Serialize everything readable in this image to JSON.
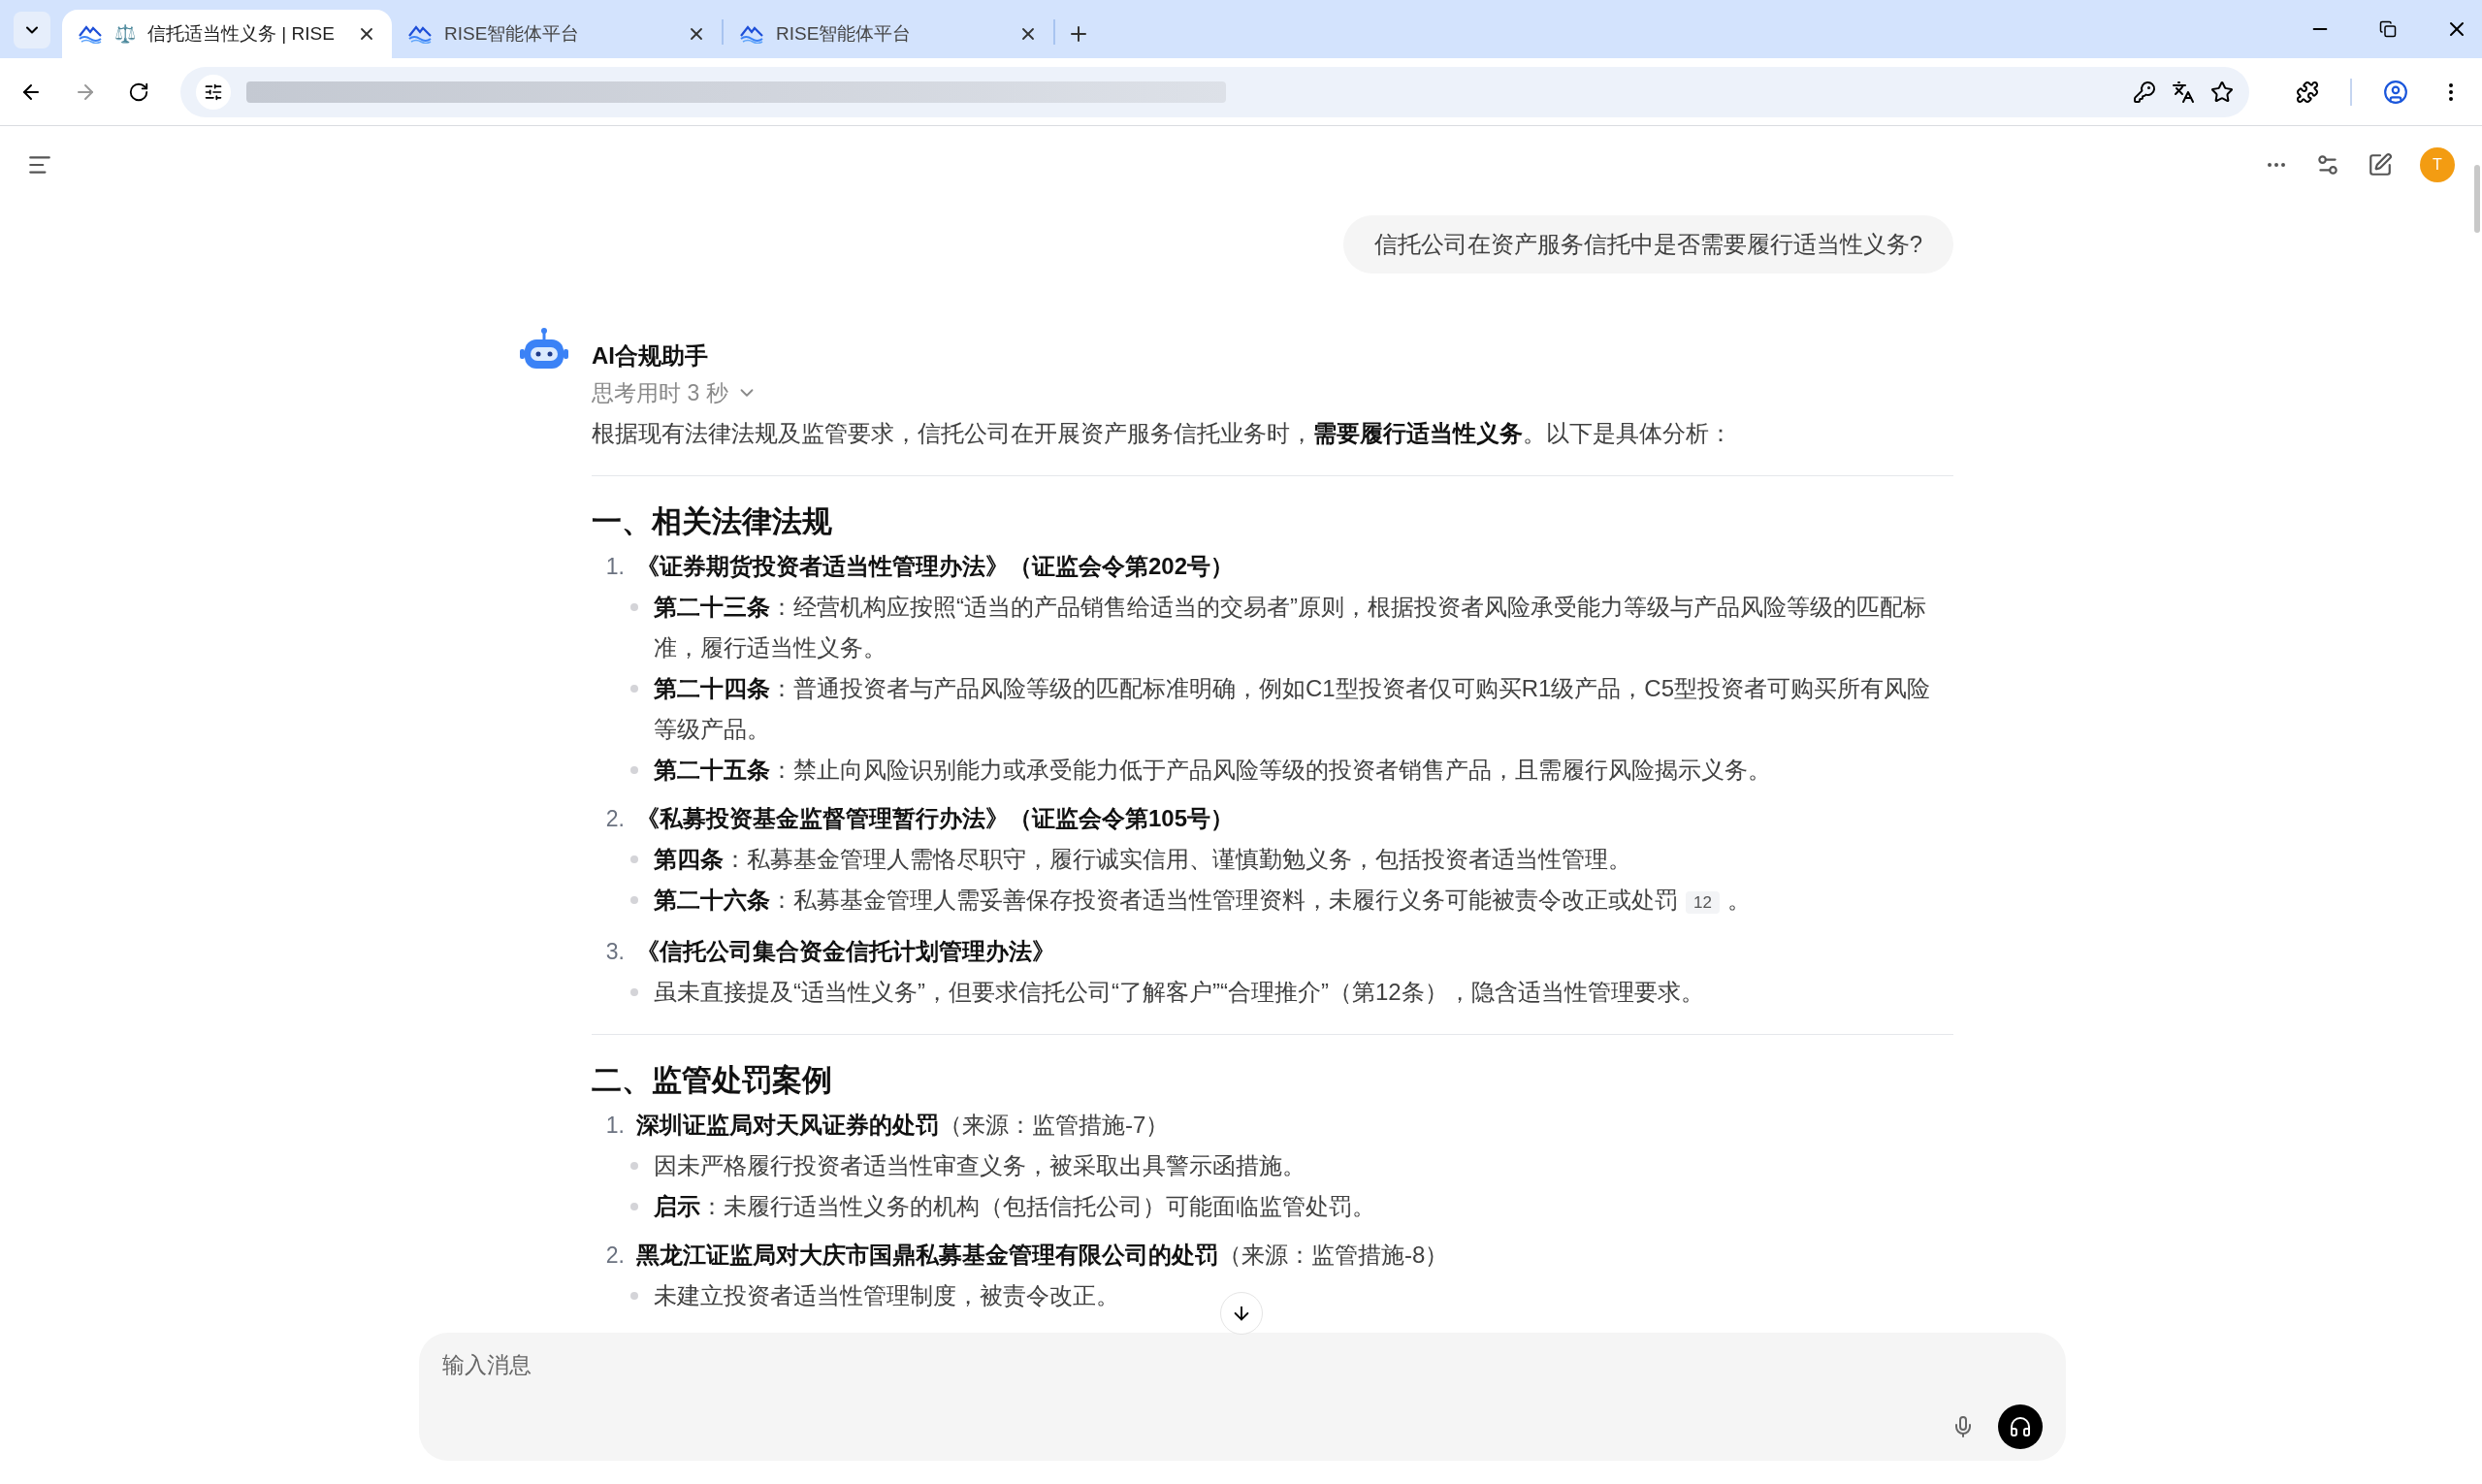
{
  "browser": {
    "tabs": [
      {
        "title": "信托适当性义务 | RISE",
        "selected": true,
        "emoji": "⚖️"
      },
      {
        "title": "RISE智能体平台",
        "selected": false
      },
      {
        "title": "RISE智能体平台",
        "selected": false
      }
    ]
  },
  "app": {
    "user_avatar": "T"
  },
  "conversation": {
    "user_message": "信托公司在资产服务信托中是否需要履行适当性义务?",
    "assistant": {
      "name": "AI合规助手",
      "thinking": "思考用时 3 秒",
      "intro": "根据现有法律法规及监管要求，信托公司在开展资产服务信托业务时，**需要履行适当性义务**。以下是具体分析：",
      "sections": [
        {
          "heading": "一、相关法律法规",
          "items": [
            {
              "number": "1.",
              "title": "《证券期货投资者适当性管理办法》（证监会令第202号）",
              "bullets": [
                {
                  "text": "**第二十三条**：经营机构应按照“适当的产品销售给适当的交易者”原则，根据投资者风险承受能力等级与产品风险等级的匹配标准，履行适当性义务。"
                },
                {
                  "text": "**第二十四条**：普通投资者与产品风险等级的匹配标准明确，例如C1型投资者仅可购买R1级产品，C5型投资者可购买所有风险等级产品。"
                },
                {
                  "text": "**第二十五条**：禁止向风险识别能力或承受能力低于产品风险等级的投资者销售产品，且需履行风险揭示义务。"
                }
              ]
            },
            {
              "number": "2.",
              "title": "《私募投资基金监督管理暂行办法》（证监会令第105号）",
              "bullets": [
                {
                  "text": "**第四条**：私募基金管理人需恪尽职守，履行诚实信用、谨慎勤勉义务，包括投资者适当性管理。"
                },
                {
                  "text": "**第二十六条**：私募基金管理人需妥善保存投资者适当性管理资料，未履行义务可能被责令改正或处罚",
                  "citation": "12",
                  "tail": "。"
                }
              ]
            },
            {
              "number": "3.",
              "title": "《信托公司集合资金信托计划管理办法》",
              "bullets": [
                {
                  "text": "虽未直接提及“适当性义务”，但要求信托公司“了解客户”“合理推介”（第12条），隐含适当性管理要求。"
                }
              ]
            }
          ]
        },
        {
          "heading": "二、监管处罚案例",
          "items": [
            {
              "number": "1.",
              "title": "深圳证监局对天风证券的处罚",
              "note": "（来源：监管措施-7）",
              "bullets": [
                {
                  "text": "因未严格履行投资者适当性审查义务，被采取出具警示函措施。"
                },
                {
                  "text": "**启示**：未履行适当性义务的机构（包括信托公司）可能面临监管处罚。"
                }
              ]
            },
            {
              "number": "2.",
              "title": "黑龙江证监局对大庆市国鼎私募基金管理有限公司的处罚",
              "note": "（来源：监管措施-8）",
              "bullets": [
                {
                  "text": "未建立投资者适当性管理制度，被责令改正。"
                }
              ]
            }
          ]
        }
      ]
    }
  },
  "composer": {
    "placeholder": "输入消息"
  }
}
